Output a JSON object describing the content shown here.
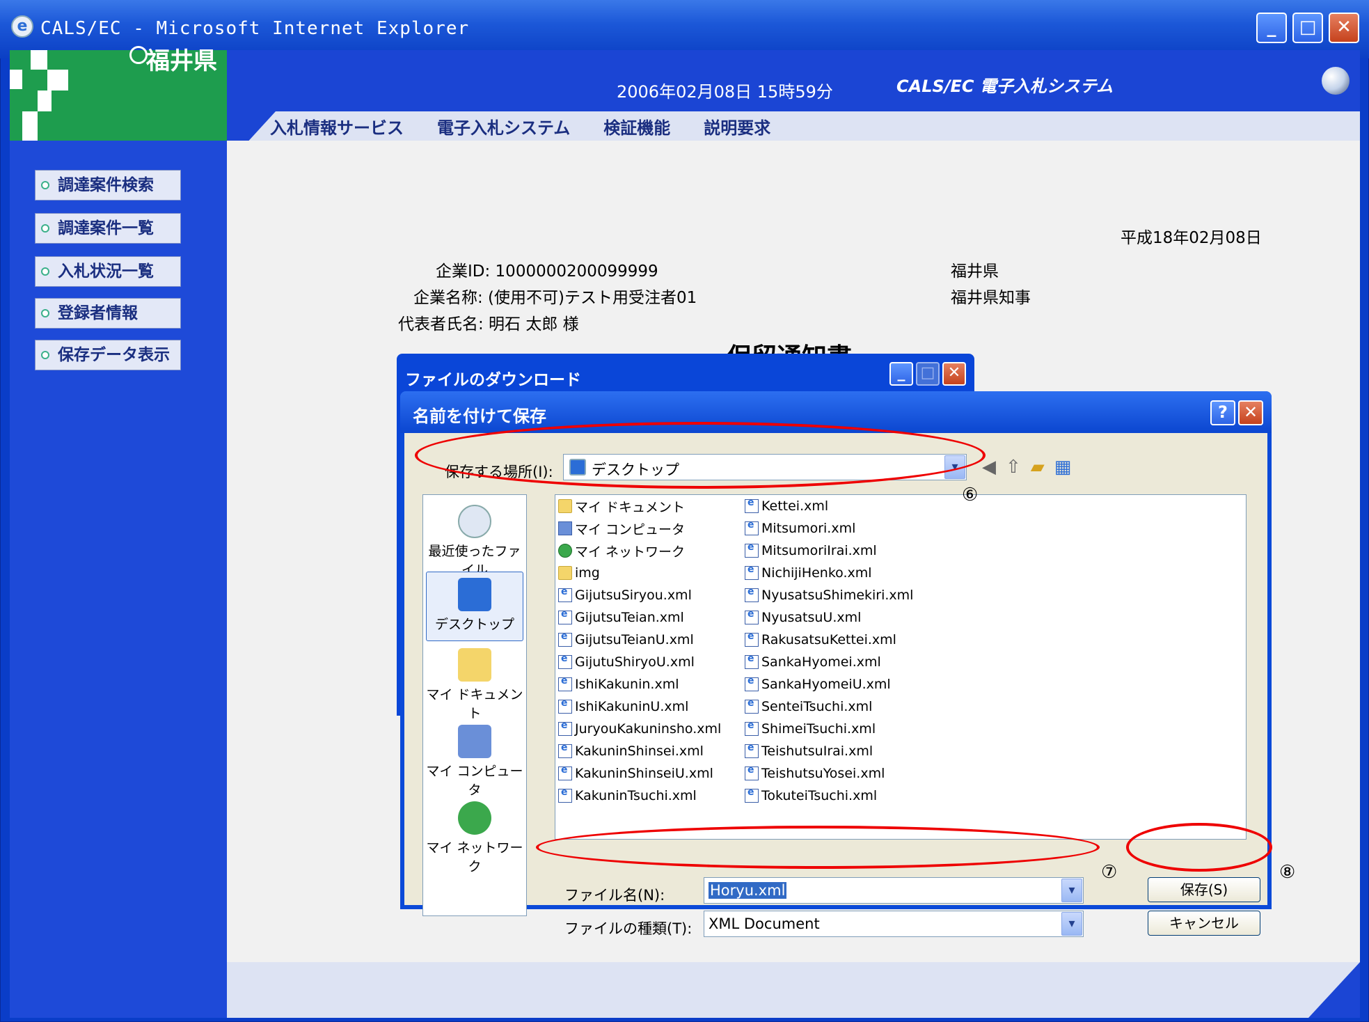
{
  "window": {
    "title": "CALS/EC - Microsoft Internet Explorer"
  },
  "header": {
    "logo_text": "福井県",
    "date_time": "2006年02月08日 15時59分",
    "system_name": "CALS/EC 電子入札システム",
    "nav": [
      "入札情報サービス",
      "電子入札システム",
      "検証機能",
      "説明要求"
    ]
  },
  "sidebar": {
    "items": [
      {
        "label": "調達案件検索"
      },
      {
        "label": "調達案件一覧"
      },
      {
        "label": "入札状況一覧"
      },
      {
        "label": "登録者情報"
      },
      {
        "label": "保存データ表示"
      }
    ]
  },
  "document": {
    "date": "平成18年02月08日",
    "company_id": "企業ID: 1000000200099999",
    "company_name": "企業名称: (使用不可)テスト用受注者01",
    "representative": "代表者氏名: 明石 太郎 様",
    "issuer": "福井県",
    "issuer_title": "福井県知事",
    "doc_title": "保留通知書"
  },
  "download_dialog": {
    "title": "ファイルのダウンロード"
  },
  "save_dialog": {
    "title": "名前を付けて保存",
    "location_label": "保存する場所(I):",
    "location_value": "デスクトップ",
    "places": [
      "最近使ったファイル",
      "デスクトップ",
      "マイ ドキュメント",
      "マイ コンピュータ",
      "マイ ネットワーク"
    ],
    "files_col1": [
      {
        "name": "マイ ドキュメント",
        "icon": "folder"
      },
      {
        "name": "マイ コンピュータ",
        "icon": "computer"
      },
      {
        "name": "マイ ネットワーク",
        "icon": "network"
      },
      {
        "name": "img",
        "icon": "folder"
      },
      {
        "name": "GijutsuSiryou.xml",
        "icon": "xml"
      },
      {
        "name": "GijutsuTeian.xml",
        "icon": "xml"
      },
      {
        "name": "GijutsuTeianU.xml",
        "icon": "xml"
      },
      {
        "name": "GijutuShiryoU.xml",
        "icon": "xml"
      },
      {
        "name": "IshiKakunin.xml",
        "icon": "xml"
      },
      {
        "name": "IshiKakuninU.xml",
        "icon": "xml"
      },
      {
        "name": "JuryouKakuninsho.xml",
        "icon": "xml"
      },
      {
        "name": "KakuninShinsei.xml",
        "icon": "xml"
      },
      {
        "name": "KakuninShinseiU.xml",
        "icon": "xml"
      },
      {
        "name": "KakuninTsuchi.xml",
        "icon": "xml"
      }
    ],
    "files_col2": [
      {
        "name": "Kettei.xml",
        "icon": "xml"
      },
      {
        "name": "Mitsumori.xml",
        "icon": "xml"
      },
      {
        "name": "MitsumoriIrai.xml",
        "icon": "xml"
      },
      {
        "name": "NichijiHenko.xml",
        "icon": "xml"
      },
      {
        "name": "NyusatsuShimekiri.xml",
        "icon": "xml"
      },
      {
        "name": "NyusatsuU.xml",
        "icon": "xml"
      },
      {
        "name": "RakusatsuKettei.xml",
        "icon": "xml"
      },
      {
        "name": "SankaHyomei.xml",
        "icon": "xml"
      },
      {
        "name": "SankaHyomeiU.xml",
        "icon": "xml"
      },
      {
        "name": "SenteiTsuchi.xml",
        "icon": "xml"
      },
      {
        "name": "ShimeiTsuchi.xml",
        "icon": "xml"
      },
      {
        "name": "TeishutsuIrai.xml",
        "icon": "xml"
      },
      {
        "name": "TeishutsuYosei.xml",
        "icon": "xml"
      },
      {
        "name": "TokuteiTsuchi.xml",
        "icon": "xml"
      }
    ],
    "filename_label": "ファイル名(N):",
    "filename_value": "Horyu.xml",
    "filetype_label": "ファイルの種類(T):",
    "filetype_value": "XML Document",
    "save_label": "保存(S)",
    "cancel_label": "キャンセル"
  },
  "annotations": [
    "⑥",
    "⑦",
    "⑧"
  ],
  "colors": {
    "annotation": "#e00000",
    "title_blue": "#0b46d0",
    "logo_green": "#1e9d4e"
  }
}
